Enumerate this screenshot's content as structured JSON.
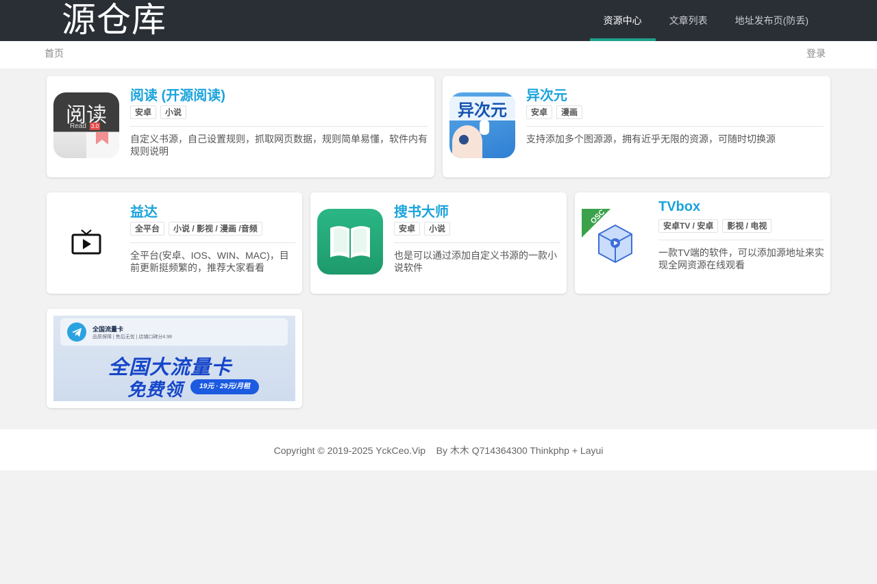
{
  "header": {
    "logo": "源仓库",
    "nav": [
      {
        "label": "资源中心",
        "active": true
      },
      {
        "label": "文章列表",
        "active": false
      },
      {
        "label": "地址发布页(防丢)",
        "active": false
      }
    ]
  },
  "subbar": {
    "home": "首页",
    "login": "登录"
  },
  "cards": [
    {
      "title": "阅读 (开源阅读)",
      "tags": [
        "安卓",
        "小说"
      ],
      "desc": "自定义书源，自己设置规则，抓取网页数据，规则简单易懂，软件内有规则说明",
      "icon": "yuedu-app-icon",
      "icon_text": "阅读",
      "icon_sub": "Read",
      "icon_ver": "3.0"
    },
    {
      "title": "异次元",
      "tags": [
        "安卓",
        "漫画"
      ],
      "desc": "支持添加多个图源源，拥有近乎无限的资源，可随时切换源",
      "icon": "yiciyuan-app-icon",
      "icon_text": "异次元"
    },
    {
      "title": "益达",
      "tags": [
        "全平台",
        "小说 / 影视 / 漫画 /音频"
      ],
      "desc": "全平台(安卓、IOS、WIN、MAC)，目前更新挺频繁的，推荐大家看看",
      "icon": "live-tv-icon"
    },
    {
      "title": "搜书大师",
      "tags": [
        "安卓",
        "小说"
      ],
      "desc": "也是可以通过添加自定义书源的一款小说软件",
      "icon": "open-book-icon"
    },
    {
      "title": "TVbox",
      "tags": [
        "安卓TV / 安卓",
        "影视 / 电视"
      ],
      "desc": "一款TV端的软件，可以添加源地址来实现全网资源在线观看",
      "icon": "tvbox-cube-icon",
      "ribbon": "OSC"
    }
  ],
  "ad": {
    "title": "全国流量卡",
    "subtitle": "品质保障 | 售后无忧 | 店铺口碑分4.98",
    "headline1": "全国大流量卡",
    "headline2": "免费领",
    "price": "19元 · 29元/月租",
    "icon": "telegram-icon"
  },
  "footer": {
    "text": "Copyright © 2019-2025 YckCeo.Vip    By 木木 Q714364300 Thinkphp + Layui"
  },
  "colors": {
    "header_bg": "#2a2f36",
    "accent": "#1fa08a",
    "title_blue": "#1aa3dc",
    "page_bg": "#f2f2f2"
  }
}
